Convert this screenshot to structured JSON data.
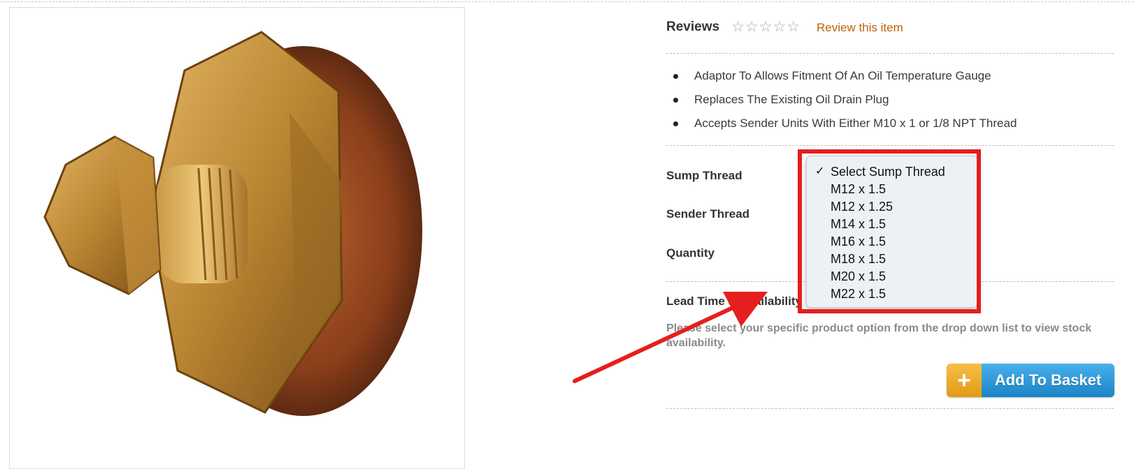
{
  "reviews": {
    "title": "Reviews",
    "stars_filled": 0,
    "stars_total": 5,
    "review_link": "Review this item"
  },
  "features": [
    "Adaptor To Allows Fitment Of An Oil Temperature Gauge",
    "Replaces The Existing Oil Drain Plug",
    "Accepts Sender Units With Either M10 x 1 or 1/8 NPT Thread"
  ],
  "options": {
    "sump_thread_label": "Sump Thread",
    "sender_thread_label": "Sender Thread",
    "quantity_label": "Quantity"
  },
  "sump_dropdown": {
    "selected": "Select Sump Thread",
    "items": [
      "Select Sump Thread",
      "M12 x 1.5",
      "M12 x 1.25",
      "M14 x 1.5",
      "M16 x 1.5",
      "M18 x 1.5",
      "M20 x 1.5",
      "M22 x 1.5"
    ]
  },
  "lead_time": {
    "label": "Lead Time & Availability",
    "message": "Please select your specific product option from the drop down list to view stock availability."
  },
  "basket_button": {
    "plus_glyph": "+",
    "label": "Add To Basket"
  },
  "colors": {
    "link": "#c0630f",
    "highlight": "#e51e1e",
    "button_blue": "#1a84c8",
    "button_orange": "#e29a16"
  }
}
